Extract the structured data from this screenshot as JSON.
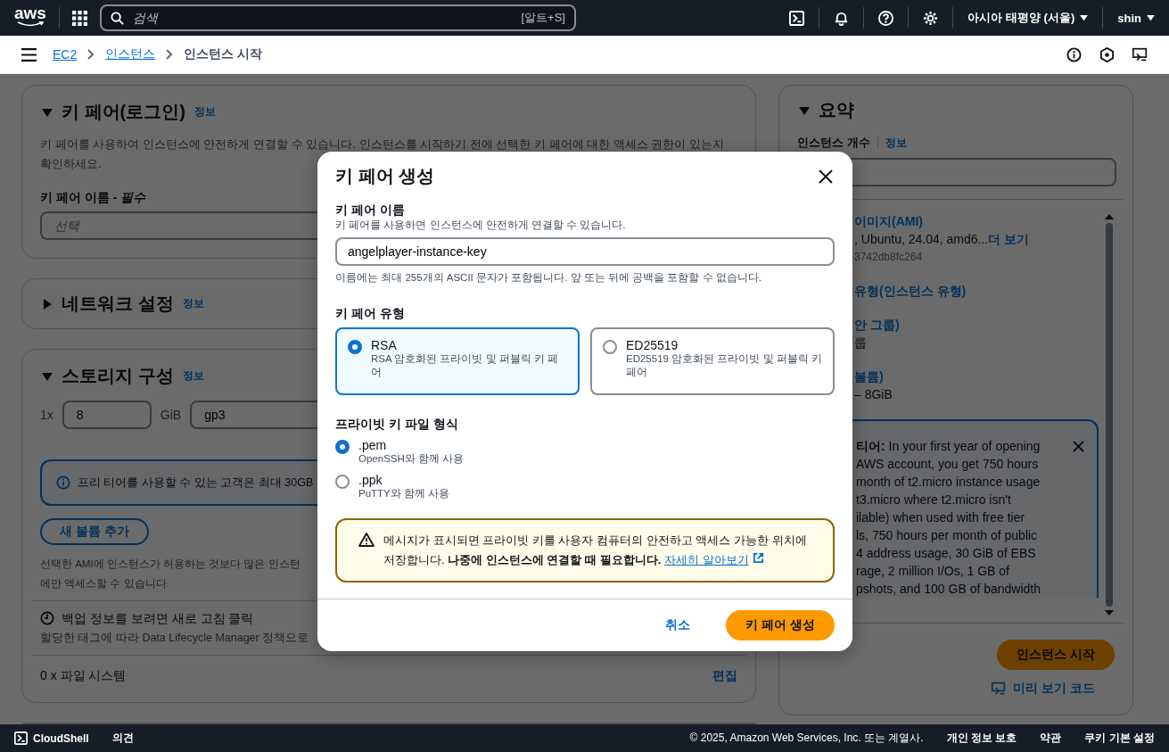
{
  "top_nav": {
    "logo": "aws",
    "search": {
      "placeholder": "검색",
      "shortcut": "[알트+S]"
    },
    "region": "아시아 태평양 (서울)",
    "user": "shin"
  },
  "breadcrumbs": [
    {
      "label": "EC2",
      "link": true
    },
    {
      "label": "인스턴스",
      "link": true
    },
    {
      "label": "인스턴스 시작",
      "link": false
    }
  ],
  "sections": [
    {
      "kind": "key_pair",
      "title": "키 페어(로그인)",
      "info": "정보",
      "expanded": true,
      "description": "키 페어를 사용하여 인스턴스에 안전하게 연결할 수 있습니다. 인스턴스를 시작하기 전에 선택한 키 페어에 대한 액세스 권한이 있는지 확인하세요.",
      "field_label": "키 페어 이름 - *필수*",
      "field_placeholder": "선택"
    },
    {
      "kind": "network",
      "title": "네트워크 설정",
      "info": "정보",
      "expanded": false
    },
    {
      "kind": "storage",
      "title": "스토리지 구성",
      "info": "정보",
      "expanded": true,
      "count": "1x",
      "size": "8",
      "unit": "GiB",
      "volume_type": "gp3",
      "alert": "프리 티어를 사용할 수 있는 고객은 최대 30GB",
      "add_button": "새 볼륨 추가",
      "notice_lines": [
        "선택한 AMI에 인스턴스가 허용하는 것보다 많은 인스턴",
        "에만 액세스할 수 있습니다."
      ],
      "backup_title": "백업 정보를 보려면 새로 고침 클릭",
      "backup_text": "할당한 태그에 따라 Data Lifecycle Manager 정책으로",
      "file_systems": "0 x 파일 시스템",
      "edit": "편집"
    }
  ],
  "summary": {
    "title": "요약",
    "expanded": true,
    "count_label": "인스턴스 개수",
    "info": "정보",
    "items": [
      {
        "heading": "이미지(AMI)",
        "value": ", Ubuntu, 24.04, amd6...",
        "more": "더 보기",
        "sub": "3742db8fc264"
      },
      {
        "heading": "유형(인스턴스 유형)"
      },
      {
        "heading": "안 그룹)",
        "value": "룹"
      },
      {
        "heading": "볼륨)",
        "value": "– 8GiB"
      }
    ],
    "free_tier_lines": [
      "**티어:** In your first year of opening",
      "AWS account, you get 750 hours",
      "month of t2.micro instance usage",
      "t3.micro where t2.micro isn't",
      "ilable) when used with free tier",
      "ls, 750 hours per month of public",
      "4 address usage, 30 GiB of EBS",
      "rage, 2 million I/Os, 1 GB of",
      "pshots, and 100 GB of bandwidth"
    ],
    "launch_button": "인스턴스 시작",
    "preview_link": "미리 보기 코드"
  },
  "modal": {
    "title": "키 페어 생성",
    "name_label": "키 페어 이름",
    "name_description": "키 페어를 사용하면 인스턴스에 안전하게 연결할 수 있습니다.",
    "name_value": "angelplayer-instance-key",
    "name_hint": "이름에는 최대 255개의 ASCII 문자가 포함됩니다. 앞 또는 뒤에 공백을 포함할 수 없습니다.",
    "type_label": "키 페어 유형",
    "types": [
      {
        "label": "RSA",
        "description": "RSA 암호화된 프라이빗 및 퍼블릭 키 페어",
        "selected": true
      },
      {
        "label": "ED25519",
        "description": "ED25519 암호화된 프라이빗 및 퍼블릭 키 페어",
        "selected": false
      }
    ],
    "format_label": "프라이빗 키 파일 형식",
    "formats": [
      {
        "label": ".pem",
        "description": "OpenSSH와 함께 사용",
        "selected": true
      },
      {
        "label": ".ppk",
        "description": "PuTTY와 함께 사용",
        "selected": false
      }
    ],
    "warning": "메시지가 표시되면 프라이빗 키를 사용자 컴퓨터의 안전하고 액세스 가능한 위치에 저장합니다. **나중에 인스턴스에 연결할 때 필요합니다.**",
    "warning_link": "자세히 알아보기",
    "cancel": "취소",
    "submit": "키 페어 생성"
  },
  "footer": {
    "cloudshell": "CloudShell",
    "feedback": "의견",
    "copyright": "© 2025, Amazon Web Services, Inc. 또는 계열사.",
    "links": [
      "개인 정보 보호",
      "약관",
      "쿠키 기본 설정"
    ]
  }
}
